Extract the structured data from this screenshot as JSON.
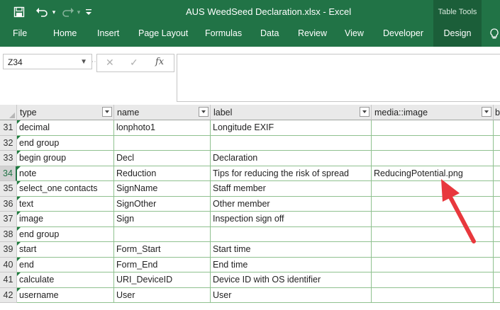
{
  "window": {
    "title": "AUS WeedSeed Declaration.xlsx  -  Excel",
    "contextual_group": "Table Tools",
    "accent_color": "#217346"
  },
  "quick_access": {
    "save_icon": "save-icon",
    "undo_icon": "undo-icon",
    "redo_icon": "redo-icon",
    "customize_icon": "customize-dropdown-icon"
  },
  "ribbon": {
    "tabs": [
      "File",
      "Home",
      "Insert",
      "Page Layout",
      "Formulas",
      "Data",
      "Review",
      "View",
      "Developer",
      "Design"
    ],
    "active_tab": "Design",
    "tell_me_icon": "lightbulb-icon"
  },
  "formula_bar": {
    "name_box": "Z34",
    "cancel_icon": "cancel-icon",
    "enter_icon": "check-icon",
    "function_label": "fx",
    "formula": ""
  },
  "grid": {
    "columns": [
      {
        "header": "type"
      },
      {
        "header": "name"
      },
      {
        "header": "label"
      },
      {
        "header": "media::image"
      },
      {
        "header": "b"
      }
    ],
    "rows": [
      {
        "num": "31",
        "cells": [
          "decimal",
          "lonphoto1",
          "Longitude EXIF",
          ""
        ]
      },
      {
        "num": "32",
        "cells": [
          "end group",
          "",
          "",
          ""
        ]
      },
      {
        "num": "33",
        "cells": [
          "begin group",
          "Decl",
          "Declaration",
          ""
        ]
      },
      {
        "num": "34",
        "cells": [
          "note",
          "Reduction",
          "Tips for reducing the risk of spread",
          "ReducingPotential.png"
        ]
      },
      {
        "num": "35",
        "cells": [
          "select_one contacts",
          "SignName",
          "Staff member",
          ""
        ]
      },
      {
        "num": "36",
        "cells": [
          "text",
          "SignOther",
          "Other member",
          ""
        ]
      },
      {
        "num": "37",
        "cells": [
          "image",
          "Sign",
          "Inspection sign off",
          ""
        ]
      },
      {
        "num": "38",
        "cells": [
          "end group",
          "",
          "",
          ""
        ]
      },
      {
        "num": "39",
        "cells": [
          "start",
          "Form_Start",
          "Start time",
          ""
        ]
      },
      {
        "num": "40",
        "cells": [
          "end",
          "Form_End",
          "End time",
          ""
        ]
      },
      {
        "num": "41",
        "cells": [
          "calculate",
          "URI_DeviceID",
          "Device ID with OS identifier",
          ""
        ]
      },
      {
        "num": "42",
        "cells": [
          "username",
          "User",
          "User",
          ""
        ]
      }
    ],
    "selected_row": "34"
  },
  "annotation": {
    "arrow_color": "#e8383d",
    "icon": "red-arrow-annotation"
  }
}
